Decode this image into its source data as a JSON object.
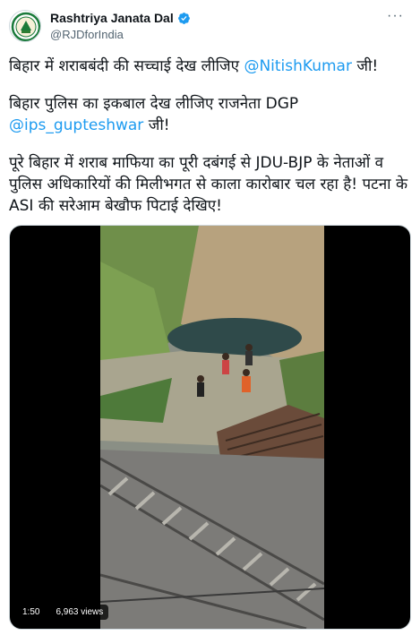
{
  "account": {
    "name": "Rashtriya Janata Dal",
    "handle": "@RJDforIndia"
  },
  "tweet": {
    "line1_text": "बिहार में शराबबंदी की सच्चाई देख लीजिए ",
    "line1_mention": "@NitishKumar",
    "line1_suffix": " जी!",
    "line2_text": "बिहार पुलिस का इकबाल देख लीजिए राजनेता DGP ",
    "line2_mention": "@ips_gupteshwar",
    "line2_suffix": " जी!",
    "line3_text": "पूरे बिहार में शराब माफिया का पूरी दबंगई से JDU-BJP के नेताओं व पुलिस अधिकारियों की मिलीभगत से काला कारोबार चल रहा है! पटना के ASI की सरेआम बेखौफ पिटाई देखिए!"
  },
  "video": {
    "duration": "1:50",
    "views": "6,963 views"
  },
  "colors": {
    "link": "#1d9bf0",
    "verified": "#1d9bf0"
  }
}
